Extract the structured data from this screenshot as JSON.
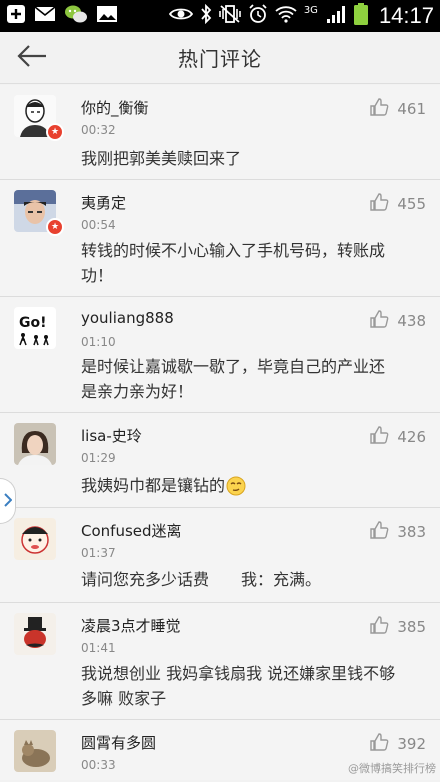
{
  "status_bar": {
    "time": "14:17",
    "network": "3G",
    "icons": [
      "plus-icon",
      "mail-icon",
      "wechat-icon",
      "image-icon",
      "eye-icon",
      "bluetooth-icon",
      "vibrate-icon",
      "alarm-icon",
      "wifi-icon",
      "signal-icon",
      "battery-icon"
    ]
  },
  "header": {
    "title": "热门评论",
    "back_icon": "arrow-left-icon"
  },
  "comments": [
    {
      "name": "你的_衡衡",
      "time": "00:32",
      "likes": "461",
      "lines": [
        "我刚把郭美美赎回来了"
      ],
      "verified": true
    },
    {
      "name": "夷勇定",
      "time": "00:54",
      "likes": "455",
      "lines": [
        "转钱的时候不小心输入了手机号码，转账成",
        "功！"
      ],
      "verified": true
    },
    {
      "name": "youliang888",
      "time": "01:10",
      "likes": "438",
      "lines": [
        "是时候让嘉诚歇一歇了，毕竟自己的产业还",
        "是亲力亲为好！"
      ],
      "verified": false
    },
    {
      "name": "lisa-史玲",
      "time": "01:29",
      "likes": "426",
      "lines": [
        "我姨妈巾都是镶钻的"
      ],
      "verified": false,
      "emoji": "smirk-emoji-icon"
    },
    {
      "name": "Confused迷离",
      "time": "01:37",
      "likes": "383",
      "lines": [
        "请问您充多少话费　　我：充满。"
      ],
      "verified": false
    },
    {
      "name": "凌晨3点才睡觉",
      "time": "01:41",
      "likes": "385",
      "lines": [
        "我说想创业 我妈拿钱扇我 说还嫌家里钱不够",
        "多嘛 败家子"
      ],
      "verified": false
    },
    {
      "name": "圆霄有多圆",
      "time": "00:33",
      "likes": "392",
      "lines": [],
      "verified": false
    }
  ],
  "watermark": "@微博搞笑排行榜",
  "colors": {
    "badge": "#e8412f",
    "background": "#f2f2f2",
    "statusbar": "#000000"
  }
}
